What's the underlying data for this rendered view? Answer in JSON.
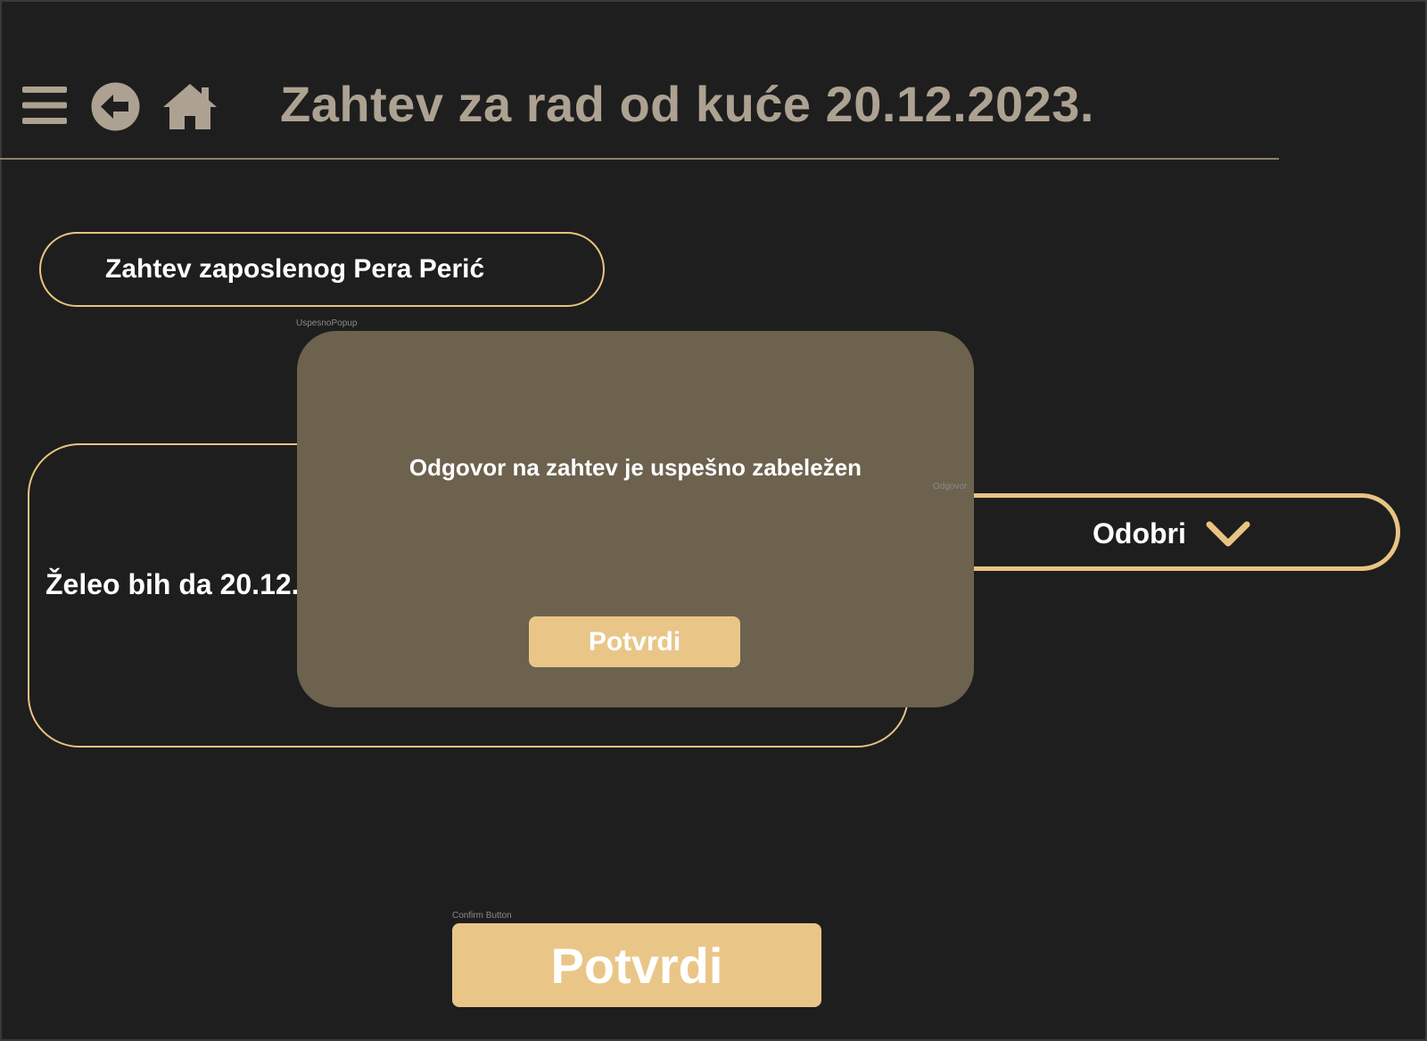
{
  "header": {
    "title": "Zahtev za rad od kuće 20.12.2023.",
    "icons": [
      "hamburger-menu-icon",
      "back-arrow-icon",
      "home-icon"
    ]
  },
  "employee": {
    "label": "Zahtev zaposlenog Pera Perić"
  },
  "request": {
    "text": "Želeo bih da 20.12."
  },
  "odgovor": {
    "layer_label": "Odgovor",
    "value": "Odobri"
  },
  "popup": {
    "layer_label": "UspesnoPopup",
    "message": "Odgovor na zahtev je uspešno zabeležen",
    "button_label": "Potvrdi"
  },
  "confirm": {
    "layer_label": "Confirm Button",
    "label": "Potvrdi"
  },
  "colors": {
    "background": "#1e1e1e",
    "accent": "#e8c482",
    "button": "#e9c688",
    "header_text": "#ada292",
    "popup_bg": "#6c624e"
  }
}
